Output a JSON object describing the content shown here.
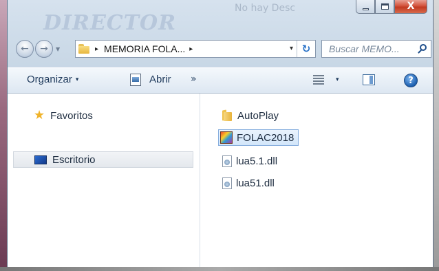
{
  "window": {
    "watermark": "DIRECTOR",
    "watermark_faint": "No hay Desc"
  },
  "caption": {
    "close_label": "X"
  },
  "address": {
    "path": "MEMORIA FOLA...",
    "path_arrow": "▸",
    "next_arrow": "▸",
    "dropdown": "▾",
    "refresh_glyph": "↻"
  },
  "search": {
    "placeholder": "Buscar MEMO..."
  },
  "toolbar": {
    "organize_label": "Organizar",
    "organize_caret": "▾",
    "open_label": "Abrir",
    "more_label": "»",
    "views_caret": "▾",
    "help_label": "?"
  },
  "navigation": {
    "items": [
      {
        "label": "Favoritos",
        "icon": "star-icon"
      },
      {
        "label": "Escritorio",
        "icon": "desktop-icon",
        "selected": true
      }
    ]
  },
  "files": [
    {
      "name": "AutoPlay",
      "icon": "folder-icon"
    },
    {
      "name": "FOLAC2018",
      "icon": "app-icon",
      "selected": true
    },
    {
      "name": "lua5.1.dll",
      "icon": "dll-icon"
    },
    {
      "name": "lua51.dll",
      "icon": "dll-icon"
    }
  ]
}
